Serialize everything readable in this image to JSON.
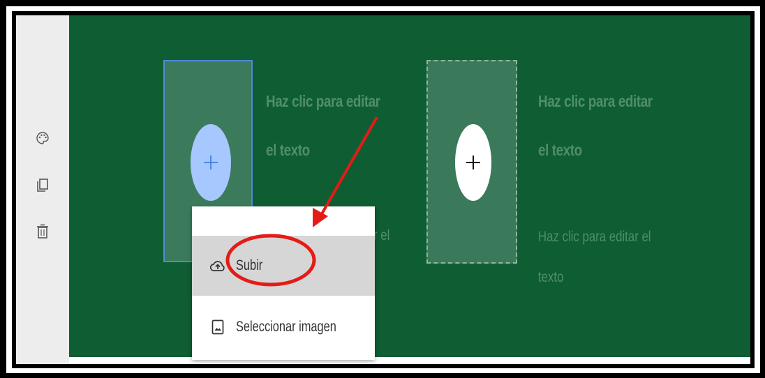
{
  "left_toolbar": {
    "icons": [
      "palette-icon",
      "duplicate-icon",
      "trash-icon"
    ]
  },
  "slots": [
    {
      "add_icon": "plus-icon",
      "title_line1": "Haz clic para editar",
      "title_line2": "el texto",
      "body_partial": "r el"
    },
    {
      "add_icon": "plus-icon",
      "title_line1": "Haz clic para editar",
      "title_line2": "el texto",
      "body_line1": "Haz clic para editar el",
      "body_line2": "texto"
    }
  ],
  "context_menu": {
    "items": [
      {
        "label": "Subir",
        "icon": "upload-cloud-icon",
        "highlighted": true
      },
      {
        "label": "Seleccionar imagen",
        "icon": "image-icon",
        "highlighted": false
      }
    ]
  },
  "annotations": {
    "arrow_color": "#e41b17",
    "ellipse_color": "#e41b17",
    "arrow_target": "Subir"
  },
  "colors": {
    "stage_bg": "#0f5d33",
    "placeholder_text": "#4f8e6b",
    "selected_border": "#4d8ad9",
    "add_button_active": "#a7c7ff"
  }
}
